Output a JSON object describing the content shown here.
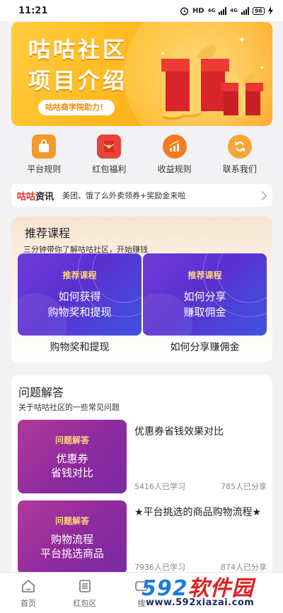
{
  "status_bar": {
    "time": "11:21",
    "network_labels": [
      "HD",
      "4G",
      "4G"
    ],
    "battery": "96"
  },
  "banner": {
    "title_line1": "咕咕社区",
    "title_line2": "项目介绍",
    "tag": "咕咕商学院助力！",
    "active_slide": 1,
    "slide_count": 2,
    "colors": {
      "bg_start": "#ffcd3f",
      "bg_end": "#ff9c12",
      "gift_red": "#e02a2a",
      "ribbon_gold": "#ffd36a"
    }
  },
  "quick_menu": [
    {
      "label": "平台规则",
      "icon": "shopping-bag-icon",
      "color": "#f29a2e"
    },
    {
      "label": "红包福利",
      "icon": "red-envelope-icon",
      "color": "#e8443a"
    },
    {
      "label": "收益规则",
      "icon": "growth-chart-icon",
      "color": "#f57a1e"
    },
    {
      "label": "联系我们",
      "icon": "refresh-contact-icon",
      "color": "#f3a63a"
    }
  ],
  "news": {
    "logo_part1": "咕咕",
    "logo_part2": "资讯",
    "text": "美团、饿了么外卖领券+奖励金来啦"
  },
  "courses": {
    "title": "推荐课程",
    "subtitle": "三分钟带你了解咕咕社区，开始赚钱",
    "items": [
      {
        "tag": "推荐课程",
        "line1": "如何获得",
        "line2": "购物奖和提现",
        "caption": "购物奖和提现"
      },
      {
        "tag": "推荐课程",
        "line1": "如何分享",
        "line2": "赚取佣金",
        "caption": "如何分享赚佣金"
      }
    ]
  },
  "faq": {
    "title": "问题解答",
    "subtitle": "关于咕咕社区的一些常见问题",
    "items": [
      {
        "tag": "问题解答",
        "line1": "优惠券",
        "line2": "省钱对比",
        "title": "优惠券省钱效果对比",
        "learners": "5416人已学习",
        "shares": "785人已分享"
      },
      {
        "tag": "问题解答",
        "line1": "购物流程",
        "line2": "平台挑选商品",
        "title": "★平台挑选的商品购物流程★",
        "learners": "7936人已学习",
        "shares": "874人已分享"
      }
    ]
  },
  "bottom_nav": [
    {
      "label": "首页",
      "icon": "home-icon"
    },
    {
      "label": "红包区",
      "icon": "list-icon"
    },
    {
      "label": "搜",
      "icon": "search-icon"
    }
  ],
  "watermark": {
    "logo_digits": "592",
    "logo_text": "软件园",
    "url": "www.592xiazai.com"
  }
}
